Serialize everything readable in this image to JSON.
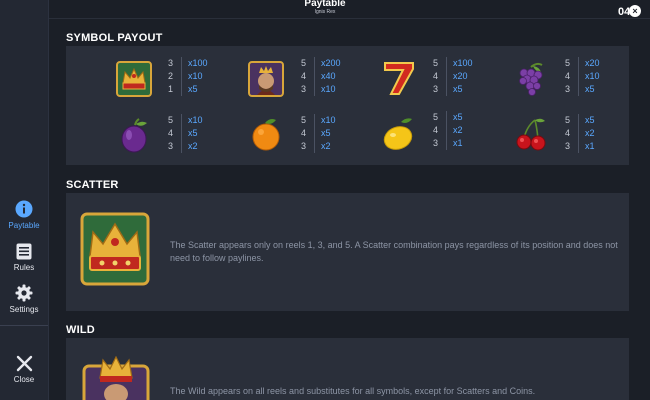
{
  "header": {
    "title": "Paytable",
    "subtitle": "Ignis Rex",
    "timer": "04",
    "close_glyph": "×"
  },
  "sidebar": {
    "items": [
      {
        "label": "Paytable",
        "icon": "info-icon",
        "active": true
      },
      {
        "label": "Rules",
        "icon": "rules-icon",
        "active": false
      },
      {
        "label": "Settings",
        "icon": "gear-icon",
        "active": false
      },
      {
        "label": "Close",
        "icon": "close-icon",
        "active": false
      }
    ]
  },
  "sections": {
    "symbol_payout": {
      "title": "SYMBOL PAYOUT",
      "symbols": [
        {
          "name": "crown",
          "pays": [
            {
              "count": "3",
              "mult": "x100"
            },
            {
              "count": "2",
              "mult": "x10"
            },
            {
              "count": "1",
              "mult": "x5"
            }
          ]
        },
        {
          "name": "king",
          "pays": [
            {
              "count": "5",
              "mult": "x200"
            },
            {
              "count": "4",
              "mult": "x40"
            },
            {
              "count": "3",
              "mult": "x10"
            }
          ]
        },
        {
          "name": "seven",
          "pays": [
            {
              "count": "5",
              "mult": "x100"
            },
            {
              "count": "4",
              "mult": "x20"
            },
            {
              "count": "3",
              "mult": "x5"
            }
          ]
        },
        {
          "name": "grapes",
          "pays": [
            {
              "count": "5",
              "mult": "x20"
            },
            {
              "count": "4",
              "mult": "x10"
            },
            {
              "count": "3",
              "mult": "x5"
            }
          ]
        },
        {
          "name": "plum",
          "pays": [
            {
              "count": "5",
              "mult": "x10"
            },
            {
              "count": "4",
              "mult": "x5"
            },
            {
              "count": "3",
              "mult": "x2"
            }
          ]
        },
        {
          "name": "orange",
          "pays": [
            {
              "count": "5",
              "mult": "x10"
            },
            {
              "count": "4",
              "mult": "x5"
            },
            {
              "count": "3",
              "mult": "x2"
            }
          ]
        },
        {
          "name": "lemon",
          "pays": [
            {
              "count": "5",
              "mult": "x5"
            },
            {
              "count": "4",
              "mult": "x2"
            },
            {
              "count": "3",
              "mult": "x1"
            }
          ]
        },
        {
          "name": "cherry",
          "pays": [
            {
              "count": "5",
              "mult": "x5"
            },
            {
              "count": "4",
              "mult": "x2"
            },
            {
              "count": "3",
              "mult": "x1"
            }
          ]
        }
      ]
    },
    "scatter": {
      "title": "SCATTER",
      "description": "The Scatter appears only on reels 1, 3, and 5. A Scatter combination pays regardless of its position and does not need to follow paylines."
    },
    "wild": {
      "title": "WILD",
      "description": "The Wild appears on all reels and substitutes for all symbols, except for Scatters and Coins."
    }
  },
  "colors": {
    "accent": "#5aa8ff",
    "background": "#1b1f27",
    "panel": "#2a2f3a",
    "sidebar": "#232833"
  }
}
